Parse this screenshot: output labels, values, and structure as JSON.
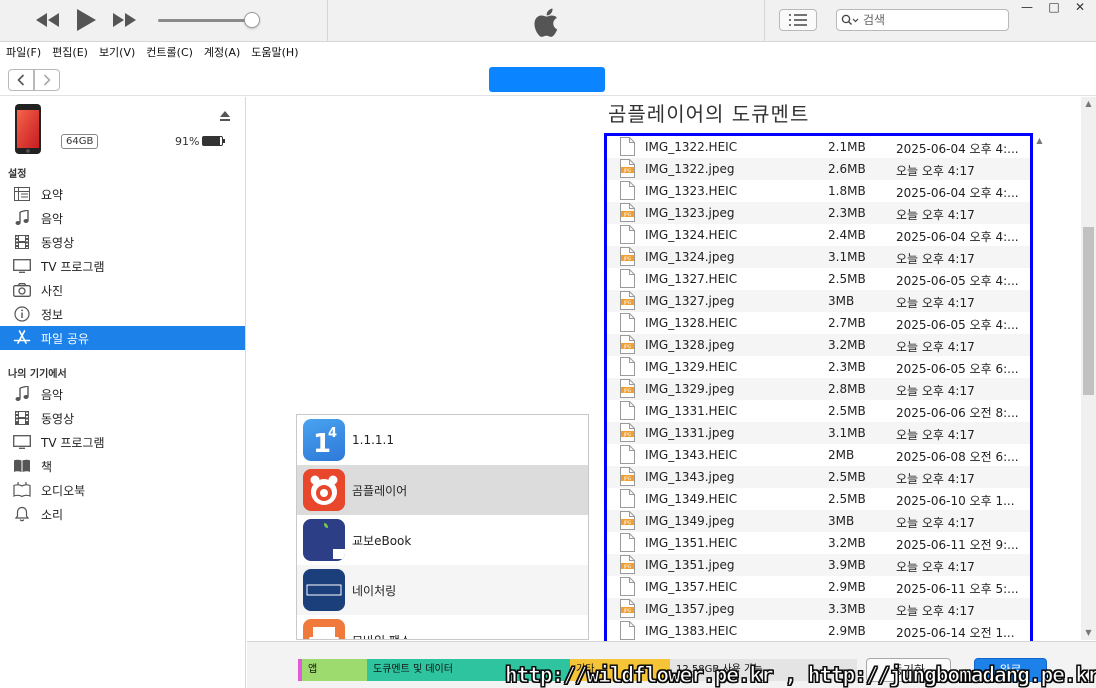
{
  "window": {
    "search_placeholder": "검색",
    "minimize": "—",
    "maximize": "□",
    "close": "✕"
  },
  "menu": [
    "파일(F)",
    "편집(E)",
    "보기(V)",
    "컨트롤(C)",
    "계정(A)",
    "도움말(H)"
  ],
  "colors": {
    "accent": "#1c81e8",
    "device_pill": "#0a84ff",
    "highlight_border": "#0000ff"
  },
  "device": {
    "capacity": "64GB",
    "battery_pct": "91%",
    "battery_level": 0.91
  },
  "sidebar": {
    "settings_header": "설정",
    "settings_items": [
      {
        "label": "요약",
        "icon": "summary-icon"
      },
      {
        "label": "음악",
        "icon": "music-icon"
      },
      {
        "label": "동영상",
        "icon": "film-icon"
      },
      {
        "label": "TV 프로그램",
        "icon": "tv-icon"
      },
      {
        "label": "사진",
        "icon": "camera-icon"
      },
      {
        "label": "정보",
        "icon": "info-icon"
      },
      {
        "label": "파일 공유",
        "icon": "app-store-icon",
        "active": true
      }
    ],
    "on_device_header": "나의 기기에서",
    "device_items": [
      {
        "label": "음악",
        "icon": "music-icon"
      },
      {
        "label": "동영상",
        "icon": "film-icon"
      },
      {
        "label": "TV 프로그램",
        "icon": "tv-icon"
      },
      {
        "label": "책",
        "icon": "book-icon"
      },
      {
        "label": "오디오북",
        "icon": "audiobook-icon"
      },
      {
        "label": "소리",
        "icon": "bell-icon"
      }
    ]
  },
  "main": {
    "doc_title": "곰플레이어의 도큐멘트",
    "apps": [
      {
        "name": "1.1.1.1"
      },
      {
        "name": "곰플레이어",
        "selected": true
      },
      {
        "name": "교보eBook"
      },
      {
        "name": "네이처링"
      },
      {
        "name": "모바일 팩스"
      }
    ],
    "files": [
      {
        "name": "IMG_1322.HEIC",
        "size": "2.1MB",
        "date": "2025-06-04 오후 4:...",
        "type": "heic"
      },
      {
        "name": "IMG_1322.jpeg",
        "size": "2.6MB",
        "date": "오늘 오후 4:17",
        "type": "jpg"
      },
      {
        "name": "IMG_1323.HEIC",
        "size": "1.8MB",
        "date": "2025-06-04 오후 4:...",
        "type": "heic"
      },
      {
        "name": "IMG_1323.jpeg",
        "size": "2.3MB",
        "date": "오늘 오후 4:17",
        "type": "jpg"
      },
      {
        "name": "IMG_1324.HEIC",
        "size": "2.4MB",
        "date": "2025-06-04 오후 4:...",
        "type": "heic"
      },
      {
        "name": "IMG_1324.jpeg",
        "size": "3.1MB",
        "date": "오늘 오후 4:17",
        "type": "jpg"
      },
      {
        "name": "IMG_1327.HEIC",
        "size": "2.5MB",
        "date": "2025-06-05 오후 4:...",
        "type": "heic"
      },
      {
        "name": "IMG_1327.jpeg",
        "size": "3MB",
        "date": "오늘 오후 4:17",
        "type": "jpg"
      },
      {
        "name": "IMG_1328.HEIC",
        "size": "2.7MB",
        "date": "2025-06-05 오후 4:...",
        "type": "heic"
      },
      {
        "name": "IMG_1328.jpeg",
        "size": "3.2MB",
        "date": "오늘 오후 4:17",
        "type": "jpg"
      },
      {
        "name": "IMG_1329.HEIC",
        "size": "2.3MB",
        "date": "2025-06-05 오후 6:...",
        "type": "heic"
      },
      {
        "name": "IMG_1329.jpeg",
        "size": "2.8MB",
        "date": "오늘 오후 4:17",
        "type": "jpg"
      },
      {
        "name": "IMG_1331.HEIC",
        "size": "2.5MB",
        "date": "2025-06-06 오전 8:...",
        "type": "heic"
      },
      {
        "name": "IMG_1331.jpeg",
        "size": "3.1MB",
        "date": "오늘 오후 4:17",
        "type": "jpg"
      },
      {
        "name": "IMG_1343.HEIC",
        "size": "2MB",
        "date": "2025-06-08 오전 6:...",
        "type": "heic"
      },
      {
        "name": "IMG_1343.jpeg",
        "size": "2.5MB",
        "date": "오늘 오후 4:17",
        "type": "jpg"
      },
      {
        "name": "IMG_1349.HEIC",
        "size": "2.5MB",
        "date": "2025-06-10 오후 1...",
        "type": "heic"
      },
      {
        "name": "IMG_1349.jpeg",
        "size": "3MB",
        "date": "오늘 오후 4:17",
        "type": "jpg"
      },
      {
        "name": "IMG_1351.HEIC",
        "size": "3.2MB",
        "date": "2025-06-11 오전 9:...",
        "type": "heic"
      },
      {
        "name": "IMG_1351.jpeg",
        "size": "3.9MB",
        "date": "오늘 오후 4:17",
        "type": "jpg"
      },
      {
        "name": "IMG_1357.HEIC",
        "size": "2.9MB",
        "date": "2025-06-11 오후 5:...",
        "type": "heic"
      },
      {
        "name": "IMG_1357.jpeg",
        "size": "3.3MB",
        "date": "오늘 오후 4:17",
        "type": "jpg"
      },
      {
        "name": "IMG_1383.HEIC",
        "size": "2.9MB",
        "date": "2025-06-14 오전 1...",
        "type": "heic"
      }
    ]
  },
  "footer": {
    "storage": [
      {
        "label": "앱",
        "color": "#9edb6e",
        "fraction": 0.117
      },
      {
        "label": "도큐멘트 및 데이터",
        "color": "#2ec4a0",
        "fraction": 0.366
      },
      {
        "label": "기타",
        "color": "#f6c437",
        "fraction": 0.18
      },
      {
        "label": "12.58GB 사용 가능",
        "color": "#e4e4e4",
        "fraction": 0.337
      }
    ],
    "sync_label": "동기화",
    "done_label": "완료"
  },
  "watermark": "http://wildflower.pe.kr , http://jungbomadang.pe.kr"
}
